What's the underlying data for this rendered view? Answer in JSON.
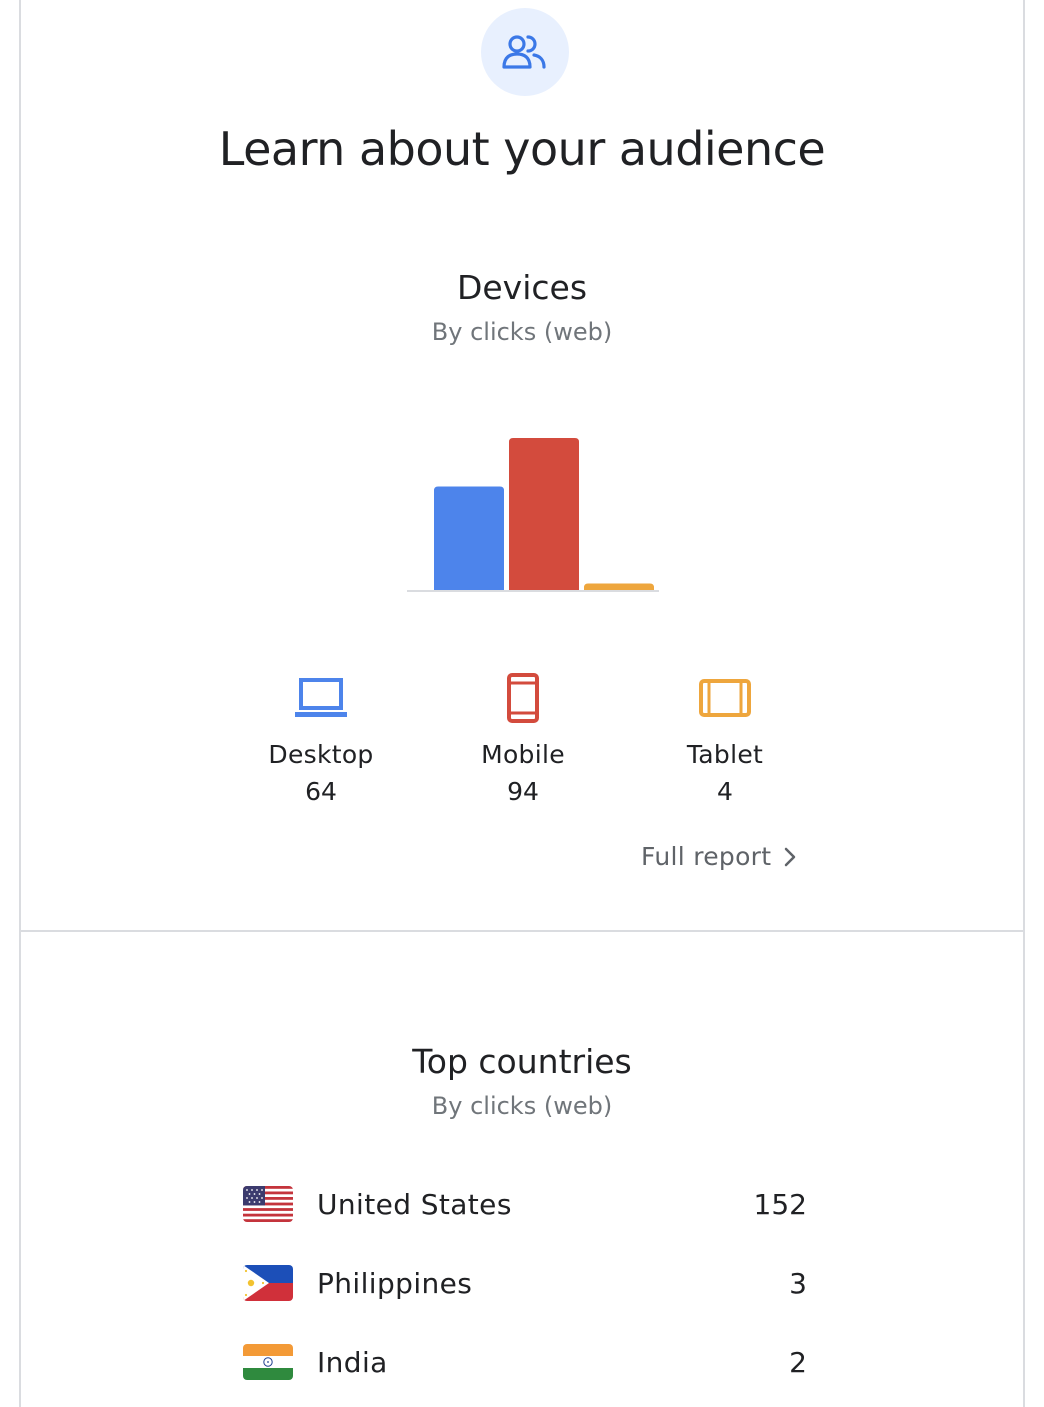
{
  "header": {
    "icon": "people-icon",
    "title": "Learn about your audience"
  },
  "devices": {
    "title": "Devices",
    "subtitle": "By clicks (web)",
    "items": [
      {
        "label": "Desktop",
        "value": "64",
        "icon": "laptop-icon",
        "color": "#4d84eb"
      },
      {
        "label": "Mobile",
        "value": "94",
        "icon": "phone-icon",
        "color": "#d34b3d"
      },
      {
        "label": "Tablet",
        "value": "4",
        "icon": "tablet-icon",
        "color": "#eea63d"
      }
    ],
    "full_report_label": "Full report"
  },
  "chart_data": {
    "type": "bar",
    "categories": [
      "Desktop",
      "Mobile",
      "Tablet"
    ],
    "values": [
      64,
      94,
      4
    ],
    "colors": [
      "#4d84eb",
      "#d34b3d",
      "#eea63d"
    ],
    "title": "Devices",
    "subtitle": "By clicks (web)",
    "ylim": [
      0,
      94
    ],
    "grid": false
  },
  "countries": {
    "title": "Top countries",
    "subtitle": "By clicks (web)",
    "items": [
      {
        "name": "United States",
        "value": "152",
        "flag": "us-flag-icon"
      },
      {
        "name": "Philippines",
        "value": "3",
        "flag": "ph-flag-icon"
      },
      {
        "name": "India",
        "value": "2",
        "flag": "in-flag-icon"
      }
    ]
  }
}
